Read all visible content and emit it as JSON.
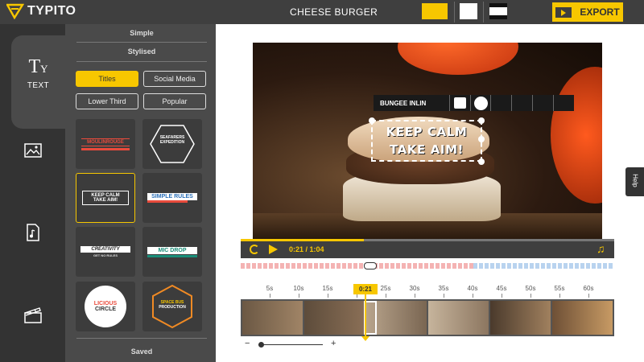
{
  "app": {
    "name": "TYPITO"
  },
  "header": {
    "title": "CHEESE BURGER",
    "export_label": "EXPORT"
  },
  "rail": {
    "text_label": "TEXT",
    "text_glyph": "T",
    "text_glyph_sub": "Y"
  },
  "panel": {
    "simple_label": "Simple",
    "stylised_label": "Stylised",
    "saved_label": "Saved",
    "categories": [
      "Titles",
      "Social Media",
      "Lower Third",
      "Popular"
    ],
    "templates": {
      "t1_line1": "MOULINROUGE",
      "t1_line2": "",
      "t2_line1": "SEAFARERS",
      "t2_line2": "EXPEDITION",
      "t3": "KEEP CALM",
      "t3b": "TAKE AIM!",
      "t4": "SIMPLE RULES",
      "t5": "CREATIVITY",
      "t5b": "GET NO RULES",
      "t6": "MIC DROP",
      "t7_line1": "LICIOUS",
      "t7_line2": "CIRCLE",
      "t8_line1": "SPACE BUS",
      "t8_line2": "PRODUCTION"
    }
  },
  "editor": {
    "font_name": "BUNGEE INLIN",
    "caption_line1": "KEEP CALM",
    "caption_line2": "TAKE AIM!"
  },
  "player": {
    "time": "0:21 / 1:04",
    "progress": 0.33
  },
  "timeline": {
    "ticks": [
      "5s",
      "10s",
      "15s",
      "0:21",
      "25s",
      "30s",
      "35s",
      "40s",
      "45s",
      "50s",
      "55s",
      "60s"
    ],
    "playhead": "0:21"
  },
  "help": {
    "label": "Help"
  },
  "colors": {
    "accent": "#f7c700",
    "dark": "#3f3f3f",
    "panel": "#4a4a4a"
  }
}
